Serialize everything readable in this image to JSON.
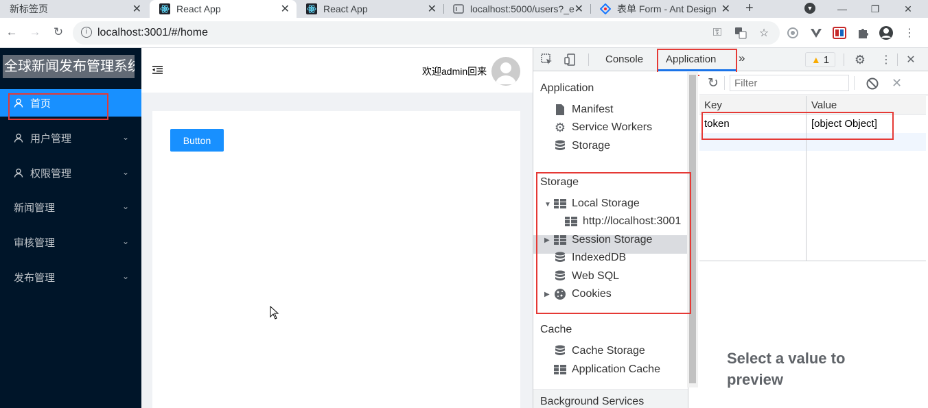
{
  "browser": {
    "tabs": [
      {
        "title": "新标签页",
        "active": false
      },
      {
        "title": "React App",
        "active": true
      },
      {
        "title": "React App",
        "active": false
      },
      {
        "title": "localhost:5000/users?_e",
        "active": false
      },
      {
        "title": "表单 Form - Ant Design",
        "active": false
      }
    ],
    "url": "localhost:3001/#/home"
  },
  "app": {
    "logo": "全球新闻发布管理系统",
    "menu": [
      {
        "label": "首页",
        "icon": "user-icon",
        "selected": true,
        "has_submenu": false
      },
      {
        "label": "用户管理",
        "icon": "user-icon",
        "selected": false,
        "has_submenu": true
      },
      {
        "label": "权限管理",
        "icon": "user-icon",
        "selected": false,
        "has_submenu": true
      },
      {
        "label": "新闻管理",
        "icon": "",
        "selected": false,
        "has_submenu": true
      },
      {
        "label": "审核管理",
        "icon": "",
        "selected": false,
        "has_submenu": true
      },
      {
        "label": "发布管理",
        "icon": "",
        "selected": false,
        "has_submenu": true
      }
    ],
    "welcome": "欢迎admin回来",
    "button_label": "Button"
  },
  "devtools": {
    "tabs": [
      "Console",
      "Application"
    ],
    "active_tab": "Application",
    "warning_count": "1",
    "sidebar": {
      "application_header": "Application",
      "application_items": [
        "Manifest",
        "Service Workers",
        "Storage"
      ],
      "storage_header": "Storage",
      "local_storage": "Local Storage",
      "local_storage_origin": "http://localhost:3001",
      "session_storage": "Session Storage",
      "indexeddb": "IndexedDB",
      "websql": "Web SQL",
      "cookies": "Cookies",
      "cache_header": "Cache",
      "cache_items": [
        "Cache Storage",
        "Application Cache"
      ],
      "background_header": "Background Services"
    },
    "storage_table": {
      "filter_placeholder": "Filter",
      "columns": [
        "Key",
        "Value"
      ],
      "rows": [
        {
          "key": "token",
          "value": "[object Object]"
        }
      ]
    },
    "preview_text": "Select a value to preview"
  },
  "colors": {
    "sider_bg": "#001529",
    "accent": "#1890ff",
    "highlight_box": "#e53935"
  }
}
